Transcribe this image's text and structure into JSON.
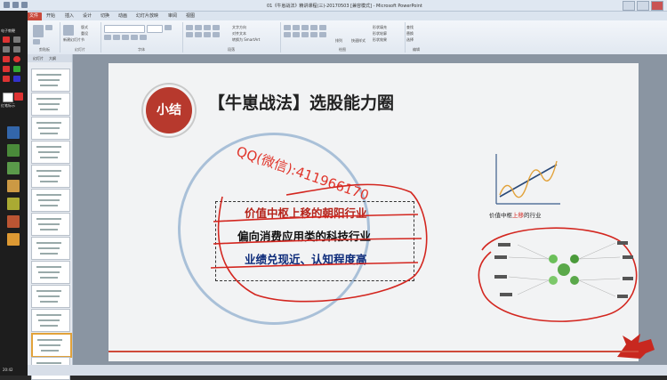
{
  "window": {
    "title": "01《牛崽战法》精讲课程(三)-20170503 [兼容模式] - Microsoft PowerPoint"
  },
  "tabs": [
    {
      "label": "文件"
    },
    {
      "label": "开始"
    },
    {
      "label": "插入"
    },
    {
      "label": "设计"
    },
    {
      "label": "切换"
    },
    {
      "label": "动画"
    },
    {
      "label": "幻灯片放映"
    },
    {
      "label": "审阅"
    },
    {
      "label": "视图"
    }
  ],
  "ribbon": {
    "groups": [
      {
        "label": "剪贴板"
      },
      {
        "label": "幻灯片"
      },
      {
        "label": "字体"
      },
      {
        "label": "段落"
      },
      {
        "label": "绘图"
      },
      {
        "label": "编辑"
      }
    ],
    "new_slide_label": "新建幻灯片",
    "layout_label": "版式",
    "reset_label": "重设",
    "section_label": "节",
    "text_direction_label": "文字方向",
    "align_text_label": "对齐文本",
    "smartart_label": "转换为 SmartArt",
    "arrange_label": "排列",
    "quick_styles_label": "快速样式",
    "shape_fill_label": "形状填充",
    "shape_outline_label": "形状轮廓",
    "shape_effects_label": "形状效果",
    "find_label": "查找",
    "replace_label": "替换",
    "select_label": "选择"
  },
  "left_tools": {
    "label": "电子教鞭",
    "redpen_label": "红笔标示"
  },
  "panel": {
    "tab_slides": "幻灯片",
    "tab_outline": "大纲",
    "slide_numbers": [
      "",
      "",
      "",
      "",
      "",
      "",
      "",
      "",
      "",
      "",
      "",
      "",
      ""
    ]
  },
  "slide": {
    "badge_text": "小结",
    "title": "【牛崽战法】选股能力圈",
    "handwritten_qq": "QQ(微信):411966170",
    "points": [
      {
        "text": "价值中枢上移的朝阳行业",
        "color": "#b5241b"
      },
      {
        "text": "偏向消费应用类的科技行业",
        "color": "#111111"
      },
      {
        "text": "业绩兑现近、认知程度高",
        "color": "#0d2b7a"
      }
    ],
    "chart_caption_prefix": "价值中枢",
    "chart_caption_highlight": "上移",
    "chart_caption_suffix": "的行业",
    "accent_color": "#b7392d",
    "highlight_color": "#e0352b"
  },
  "statusbar": {
    "time": "20:42"
  }
}
